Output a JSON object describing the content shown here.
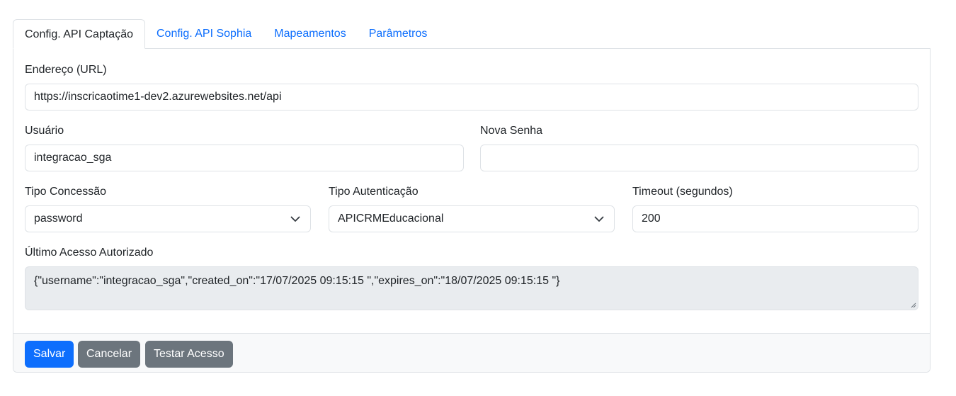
{
  "tabs": [
    {
      "label": "Config. API Captação",
      "active": true
    },
    {
      "label": "Config. API Sophia",
      "active": false
    },
    {
      "label": "Mapeamentos",
      "active": false
    },
    {
      "label": "Parâmetros",
      "active": false
    }
  ],
  "form": {
    "url": {
      "label": "Endereço (URL)",
      "value": "https://inscricaotime1-dev2.azurewebsites.net/api"
    },
    "user": {
      "label": "Usuário",
      "value": "integracao_sga"
    },
    "password": {
      "label": "Nova Senha",
      "value": ""
    },
    "grant_type": {
      "label": "Tipo Concessão",
      "value": "password"
    },
    "auth_type": {
      "label": "Tipo Autenticação",
      "value": "APICRMEducacional"
    },
    "timeout": {
      "label": "Timeout (segundos)",
      "value": "200"
    },
    "last_access": {
      "label": "Último Acesso Autorizado",
      "value": "{\"username\":\"integracao_sga\",\"created_on\":\"17/07/2025 09:15:15 \",\"expires_on\":\"18/07/2025 09:15:15 \"}"
    }
  },
  "actions": {
    "save": "Salvar",
    "cancel": "Cancelar",
    "test": "Testar Acesso"
  },
  "colors": {
    "primary": "#0d6efd",
    "secondary": "#6c757d",
    "border": "#dee2e6",
    "readonly_bg": "#e9ecef"
  }
}
